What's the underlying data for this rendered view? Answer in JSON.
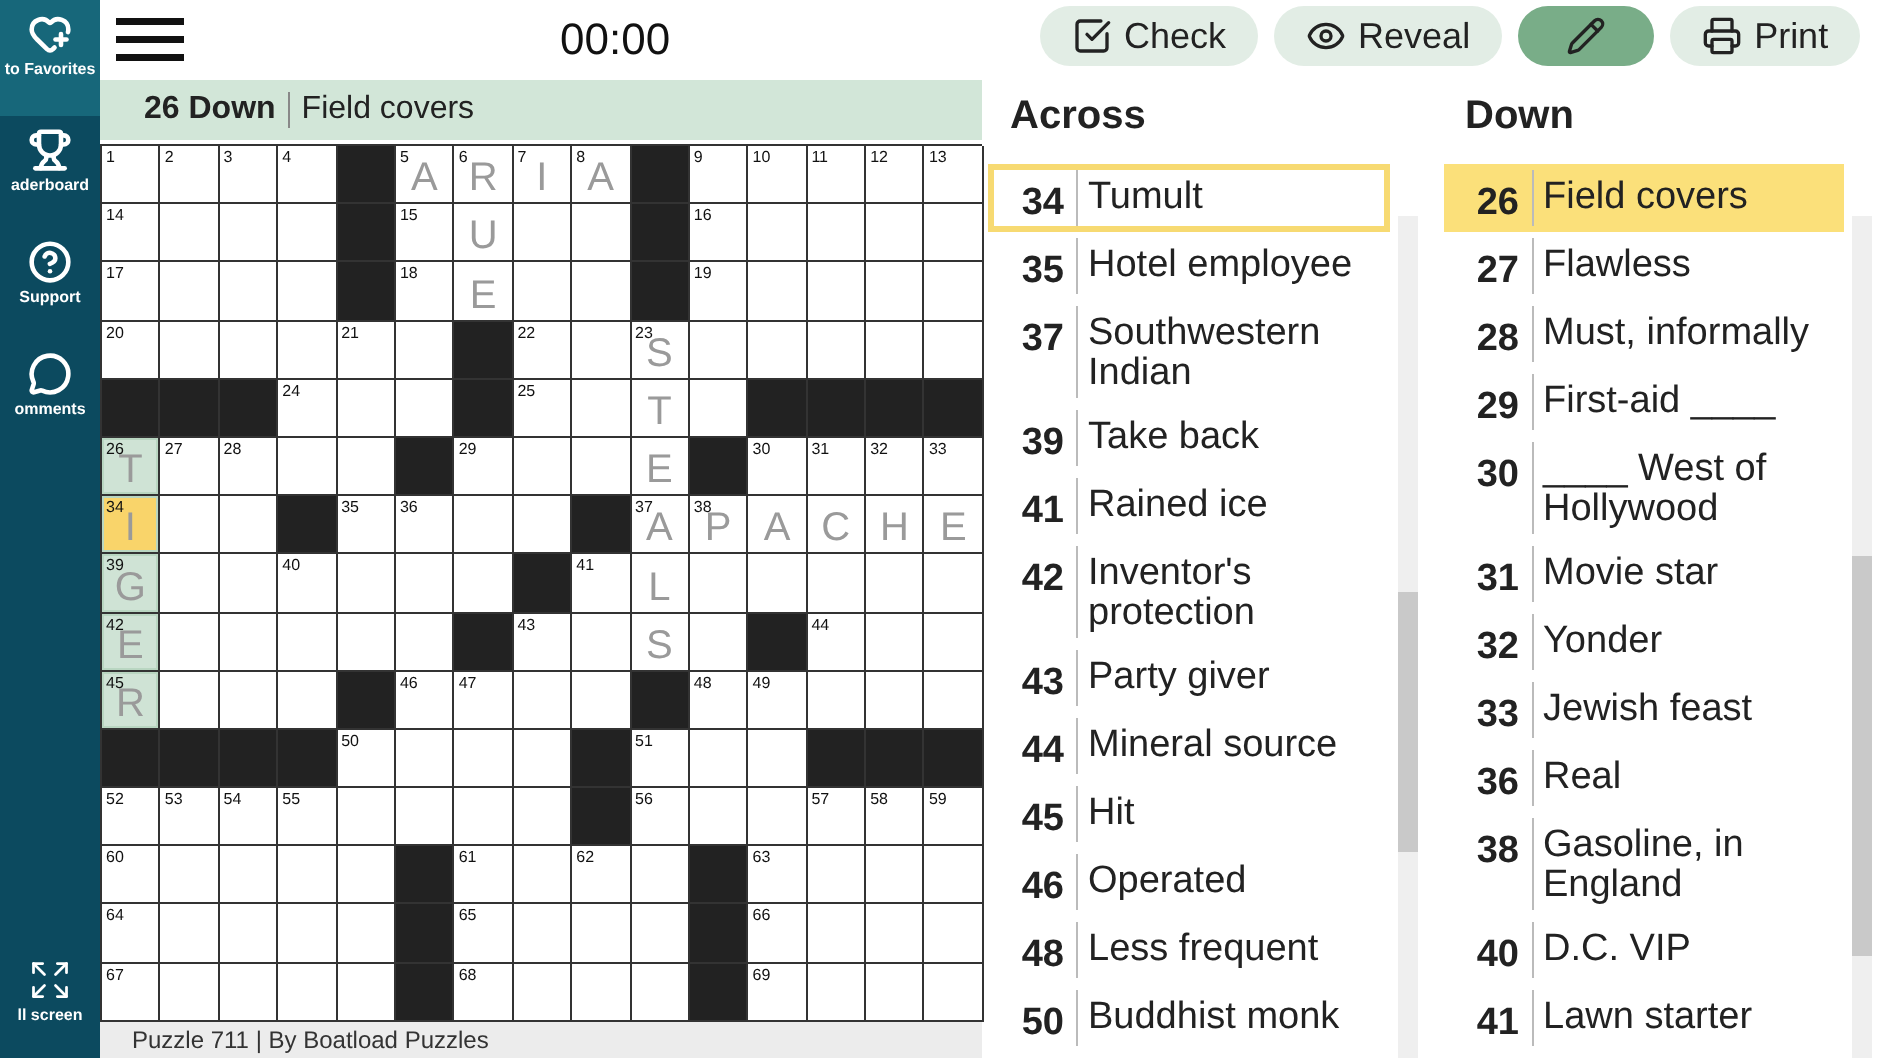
{
  "sidebar": {
    "items": [
      {
        "label": "to Favorites",
        "kind": "favorite",
        "selected": true
      },
      {
        "label": "aderboard",
        "kind": "leaderboard",
        "selected": false
      },
      {
        "label": "Support",
        "kind": "support",
        "selected": false
      },
      {
        "label": "omments",
        "kind": "comments",
        "selected": false
      },
      {
        "label": "ll screen",
        "kind": "fullscreen",
        "selected": false
      }
    ]
  },
  "timer": "00:00",
  "current_clue": {
    "label": "26 Down",
    "text": "Field covers"
  },
  "grid": {
    "rows": [
      [
        {
          "number": "1",
          "selected": false,
          "highlighted": false
        },
        {
          "number": "2",
          "selected": false,
          "highlighted": false
        },
        {
          "number": "3",
          "selected": false,
          "highlighted": false
        },
        {
          "number": "4",
          "selected": false,
          "highlighted": false
        },
        {
          "block": true
        },
        {
          "number": "5",
          "letter": "A",
          "selected": false,
          "highlighted": false
        },
        {
          "number": "6",
          "letter": "R",
          "selected": false,
          "highlighted": false
        },
        {
          "number": "7",
          "letter": "I",
          "selected": false,
          "highlighted": false
        },
        {
          "number": "8",
          "letter": "A",
          "selected": false,
          "highlighted": false
        },
        {
          "block": true
        },
        {
          "number": "9",
          "selected": false,
          "highlighted": false
        },
        {
          "number": "10",
          "selected": false,
          "highlighted": false
        },
        {
          "number": "11",
          "selected": false,
          "highlighted": false
        },
        {
          "number": "12",
          "selected": false,
          "highlighted": false
        },
        {
          "number": "13",
          "selected": false,
          "highlighted": false
        }
      ],
      [
        {
          "number": "14",
          "selected": false,
          "highlighted": false
        },
        {
          "selected": false,
          "highlighted": false
        },
        {
          "selected": false,
          "highlighted": false
        },
        {
          "selected": false,
          "highlighted": false
        },
        {
          "block": true
        },
        {
          "number": "15",
          "selected": false,
          "highlighted": false
        },
        {
          "letter": "U",
          "selected": false,
          "highlighted": false
        },
        {
          "selected": false,
          "highlighted": false
        },
        {
          "selected": false,
          "highlighted": false
        },
        {
          "block": true
        },
        {
          "number": "16",
          "selected": false,
          "highlighted": false
        },
        {
          "selected": false,
          "highlighted": false
        },
        {
          "selected": false,
          "highlighted": false
        },
        {
          "selected": false,
          "highlighted": false
        },
        {
          "selected": false,
          "highlighted": false
        }
      ],
      [
        {
          "number": "17",
          "selected": false,
          "highlighted": false
        },
        {
          "selected": false,
          "highlighted": false
        },
        {
          "selected": false,
          "highlighted": false
        },
        {
          "selected": false,
          "highlighted": false
        },
        {
          "block": true
        },
        {
          "number": "18",
          "selected": false,
          "highlighted": false
        },
        {
          "letter": "E",
          "selected": false,
          "highlighted": false
        },
        {
          "selected": false,
          "highlighted": false
        },
        {
          "selected": false,
          "highlighted": false
        },
        {
          "block": true
        },
        {
          "number": "19",
          "selected": false,
          "highlighted": false
        },
        {
          "selected": false,
          "highlighted": false
        },
        {
          "selected": false,
          "highlighted": false
        },
        {
          "selected": false,
          "highlighted": false
        },
        {
          "selected": false,
          "highlighted": false
        }
      ],
      [
        {
          "number": "20",
          "selected": false,
          "highlighted": false
        },
        {
          "selected": false,
          "highlighted": false
        },
        {
          "selected": false,
          "highlighted": false
        },
        {
          "selected": false,
          "highlighted": false
        },
        {
          "number": "21",
          "selected": false,
          "highlighted": false
        },
        {
          "selected": false,
          "highlighted": false
        },
        {
          "block": true
        },
        {
          "number": "22",
          "selected": false,
          "highlighted": false
        },
        {
          "selected": false,
          "highlighted": false
        },
        {
          "number": "23",
          "letter": "S",
          "selected": false,
          "highlighted": false
        },
        {
          "selected": false,
          "highlighted": false
        },
        {
          "selected": false,
          "highlighted": false
        },
        {
          "selected": false,
          "highlighted": false
        },
        {
          "selected": false,
          "highlighted": false
        },
        {
          "selected": false,
          "highlighted": false
        }
      ],
      [
        {
          "block": true
        },
        {
          "block": true
        },
        {
          "block": true
        },
        {
          "number": "24",
          "selected": false,
          "highlighted": false
        },
        {
          "selected": false,
          "highlighted": false
        },
        {
          "selected": false,
          "highlighted": false
        },
        {
          "block": true
        },
        {
          "number": "25",
          "selected": false,
          "highlighted": false
        },
        {
          "selected": false,
          "highlighted": false
        },
        {
          "letter": "T",
          "selected": false,
          "highlighted": false
        },
        {
          "selected": false,
          "highlighted": false
        },
        {
          "block": true
        },
        {
          "block": true
        },
        {
          "block": true
        },
        {
          "block": true
        }
      ],
      [
        {
          "number": "26",
          "letter": "T",
          "selected": false,
          "highlighted": true
        },
        {
          "number": "27",
          "selected": false,
          "highlighted": false
        },
        {
          "number": "28",
          "selected": false,
          "highlighted": false
        },
        {
          "selected": false,
          "highlighted": false
        },
        {
          "selected": false,
          "highlighted": false
        },
        {
          "block": true
        },
        {
          "number": "29",
          "selected": false,
          "highlighted": false
        },
        {
          "selected": false,
          "highlighted": false
        },
        {
          "selected": false,
          "highlighted": false
        },
        {
          "letter": "E",
          "selected": false,
          "highlighted": false
        },
        {
          "block": true
        },
        {
          "number": "30",
          "selected": false,
          "highlighted": false
        },
        {
          "number": "31",
          "selected": false,
          "highlighted": false
        },
        {
          "number": "32",
          "selected": false,
          "highlighted": false
        },
        {
          "number": "33",
          "selected": false,
          "highlighted": false
        }
      ],
      [
        {
          "number": "34",
          "letter": "I",
          "selected": true,
          "highlighted": true
        },
        {
          "selected": false,
          "highlighted": false
        },
        {
          "selected": false,
          "highlighted": false
        },
        {
          "block": true
        },
        {
          "number": "35",
          "selected": false,
          "highlighted": false
        },
        {
          "number": "36",
          "selected": false,
          "highlighted": false
        },
        {
          "selected": false,
          "highlighted": false
        },
        {
          "selected": false,
          "highlighted": false
        },
        {
          "block": true
        },
        {
          "number": "37",
          "letter": "A",
          "selected": false,
          "highlighted": false
        },
        {
          "number": "38",
          "letter": "P",
          "selected": false,
          "highlighted": false
        },
        {
          "letter": "A",
          "selected": false,
          "highlighted": false
        },
        {
          "letter": "C",
          "selected": false,
          "highlighted": false
        },
        {
          "letter": "H",
          "selected": false,
          "highlighted": false
        },
        {
          "letter": "E",
          "selected": false,
          "highlighted": false
        }
      ],
      [
        {
          "number": "39",
          "letter": "G",
          "selected": false,
          "highlighted": true
        },
        {
          "selected": false,
          "highlighted": false
        },
        {
          "selected": false,
          "highlighted": false
        },
        {
          "number": "40",
          "selected": false,
          "highlighted": false
        },
        {
          "selected": false,
          "highlighted": false
        },
        {
          "selected": false,
          "highlighted": false
        },
        {
          "selected": false,
          "highlighted": false
        },
        {
          "block": true
        },
        {
          "number": "41",
          "selected": false,
          "highlighted": false
        },
        {
          "letter": "L",
          "selected": false,
          "highlighted": false
        },
        {
          "selected": false,
          "highlighted": false
        },
        {
          "selected": false,
          "highlighted": false
        },
        {
          "selected": false,
          "highlighted": false
        },
        {
          "selected": false,
          "highlighted": false
        },
        {
          "selected": false,
          "highlighted": false
        }
      ],
      [
        {
          "number": "42",
          "letter": "E",
          "selected": false,
          "highlighted": true
        },
        {
          "selected": false,
          "highlighted": false
        },
        {
          "selected": false,
          "highlighted": false
        },
        {
          "selected": false,
          "highlighted": false
        },
        {
          "selected": false,
          "highlighted": false
        },
        {
          "selected": false,
          "highlighted": false
        },
        {
          "block": true
        },
        {
          "number": "43",
          "selected": false,
          "highlighted": false
        },
        {
          "selected": false,
          "highlighted": false
        },
        {
          "letter": "S",
          "selected": false,
          "highlighted": false
        },
        {
          "selected": false,
          "highlighted": false
        },
        {
          "block": true
        },
        {
          "number": "44",
          "selected": false,
          "highlighted": false
        },
        {
          "selected": false,
          "highlighted": false
        },
        {
          "selected": false,
          "highlighted": false
        }
      ],
      [
        {
          "number": "45",
          "letter": "R",
          "selected": false,
          "highlighted": true
        },
        {
          "selected": false,
          "highlighted": false
        },
        {
          "selected": false,
          "highlighted": false
        },
        {
          "selected": false,
          "highlighted": false
        },
        {
          "block": true
        },
        {
          "number": "46",
          "selected": false,
          "highlighted": false
        },
        {
          "number": "47",
          "selected": false,
          "highlighted": false
        },
        {
          "selected": false,
          "highlighted": false
        },
        {
          "selected": false,
          "highlighted": false
        },
        {
          "block": true
        },
        {
          "number": "48",
          "selected": false,
          "highlighted": false
        },
        {
          "number": "49",
          "selected": false,
          "highlighted": false
        },
        {
          "selected": false,
          "highlighted": false
        },
        {
          "selected": false,
          "highlighted": false
        },
        {
          "selected": false,
          "highlighted": false
        }
      ],
      [
        {
          "block": true
        },
        {
          "block": true
        },
        {
          "block": true
        },
        {
          "block": true
        },
        {
          "number": "50",
          "selected": false,
          "highlighted": false
        },
        {
          "selected": false,
          "highlighted": false
        },
        {
          "selected": false,
          "highlighted": false
        },
        {
          "selected": false,
          "highlighted": false
        },
        {
          "block": true
        },
        {
          "number": "51",
          "selected": false,
          "highlighted": false
        },
        {
          "selected": false,
          "highlighted": false
        },
        {
          "selected": false,
          "highlighted": false
        },
        {
          "block": true
        },
        {
          "block": true
        },
        {
          "block": true
        }
      ],
      [
        {
          "number": "52",
          "selected": false,
          "highlighted": false
        },
        {
          "number": "53",
          "selected": false,
          "highlighted": false
        },
        {
          "number": "54",
          "selected": false,
          "highlighted": false
        },
        {
          "number": "55",
          "selected": false,
          "highlighted": false
        },
        {
          "selected": false,
          "highlighted": false
        },
        {
          "selected": false,
          "highlighted": false
        },
        {
          "selected": false,
          "highlighted": false
        },
        {
          "selected": false,
          "highlighted": false
        },
        {
          "block": true
        },
        {
          "number": "56",
          "selected": false,
          "highlighted": false
        },
        {
          "selected": false,
          "highlighted": false
        },
        {
          "selected": false,
          "highlighted": false
        },
        {
          "number": "57",
          "selected": false,
          "highlighted": false
        },
        {
          "number": "58",
          "selected": false,
          "highlighted": false
        },
        {
          "number": "59",
          "selected": false,
          "highlighted": false
        }
      ],
      [
        {
          "number": "60",
          "selected": false,
          "highlighted": false
        },
        {
          "selected": false,
          "highlighted": false
        },
        {
          "selected": false,
          "highlighted": false
        },
        {
          "selected": false,
          "highlighted": false
        },
        {
          "selected": false,
          "highlighted": false
        },
        {
          "block": true
        },
        {
          "number": "61",
          "selected": false,
          "highlighted": false
        },
        {
          "selected": false,
          "highlighted": false
        },
        {
          "number": "62",
          "selected": false,
          "highlighted": false
        },
        {
          "selected": false,
          "highlighted": false
        },
        {
          "block": true
        },
        {
          "number": "63",
          "selected": false,
          "highlighted": false
        },
        {
          "selected": false,
          "highlighted": false
        },
        {
          "selected": false,
          "highlighted": false
        },
        {
          "selected": false,
          "highlighted": false
        }
      ],
      [
        {
          "number": "64",
          "selected": false,
          "highlighted": false
        },
        {
          "selected": false,
          "highlighted": false
        },
        {
          "selected": false,
          "highlighted": false
        },
        {
          "selected": false,
          "highlighted": false
        },
        {
          "selected": false,
          "highlighted": false
        },
        {
          "block": true
        },
        {
          "number": "65",
          "selected": false,
          "highlighted": false
        },
        {
          "selected": false,
          "highlighted": false
        },
        {
          "selected": false,
          "highlighted": false
        },
        {
          "selected": false,
          "highlighted": false
        },
        {
          "block": true
        },
        {
          "number": "66",
          "selected": false,
          "highlighted": false
        },
        {
          "selected": false,
          "highlighted": false
        },
        {
          "selected": false,
          "highlighted": false
        },
        {
          "selected": false,
          "highlighted": false
        }
      ],
      [
        {
          "number": "67",
          "selected": false,
          "highlighted": false
        },
        {
          "selected": false,
          "highlighted": false
        },
        {
          "selected": false,
          "highlighted": false
        },
        {
          "selected": false,
          "highlighted": false
        },
        {
          "selected": false,
          "highlighted": false
        },
        {
          "block": true
        },
        {
          "number": "68",
          "selected": false,
          "highlighted": false
        },
        {
          "selected": false,
          "highlighted": false
        },
        {
          "selected": false,
          "highlighted": false
        },
        {
          "selected": false,
          "highlighted": false
        },
        {
          "block": true
        },
        {
          "number": "69",
          "selected": false,
          "highlighted": false
        },
        {
          "selected": false,
          "highlighted": false
        },
        {
          "selected": false,
          "highlighted": false
        },
        {
          "selected": false,
          "highlighted": false
        }
      ]
    ]
  },
  "footer": "Puzzle 711 | By Boatload Puzzles",
  "toolbar": [
    {
      "kind": "check",
      "label": "Check",
      "selected": false
    },
    {
      "kind": "reveal",
      "label": "Reveal",
      "selected": false
    },
    {
      "kind": "pencil",
      "selected": true
    },
    {
      "kind": "print",
      "label": "Print",
      "selected": false
    }
  ],
  "clue_lists": [
    {
      "title": "Across",
      "clues": [
        {
          "number": "34",
          "text": "Tumult",
          "selected": true
        },
        {
          "number": "35",
          "text": "Hotel employee",
          "selected": false
        },
        {
          "number": "37",
          "text": "Southwestern Indian",
          "selected": false
        },
        {
          "number": "39",
          "text": "Take back",
          "selected": false
        },
        {
          "number": "41",
          "text": "Rained ice",
          "selected": false
        },
        {
          "number": "42",
          "text": "Inventor's protection",
          "selected": false
        },
        {
          "number": "43",
          "text": "Party giver",
          "selected": false
        },
        {
          "number": "44",
          "text": "Mineral source",
          "selected": false
        },
        {
          "number": "45",
          "text": "Hit",
          "selected": false
        },
        {
          "number": "46",
          "text": "Operated",
          "selected": false
        },
        {
          "number": "48",
          "text": "Less frequent",
          "selected": false
        },
        {
          "number": "50",
          "text": "Buddhist monk",
          "selected": false
        }
      ]
    },
    {
      "title": "Down",
      "clues": [
        {
          "number": "26",
          "text": "Field covers",
          "selected": true
        },
        {
          "number": "27",
          "text": "Flawless",
          "selected": false
        },
        {
          "number": "28",
          "text": "Must, informally",
          "selected": false
        },
        {
          "number": "29",
          "text": "First-aid ____",
          "selected": false
        },
        {
          "number": "30",
          "text": "____ West of Hollywood",
          "selected": false
        },
        {
          "number": "31",
          "text": "Movie star",
          "selected": false
        },
        {
          "number": "32",
          "text": "Yonder",
          "selected": false
        },
        {
          "number": "33",
          "text": "Jewish feast",
          "selected": false
        },
        {
          "number": "36",
          "text": "Real",
          "selected": false
        },
        {
          "number": "38",
          "text": "Gasoline, in England",
          "selected": false
        },
        {
          "number": "40",
          "text": "D.C. VIP",
          "selected": false
        },
        {
          "number": "41",
          "text": "Lawn starter",
          "selected": false
        }
      ]
    }
  ]
}
